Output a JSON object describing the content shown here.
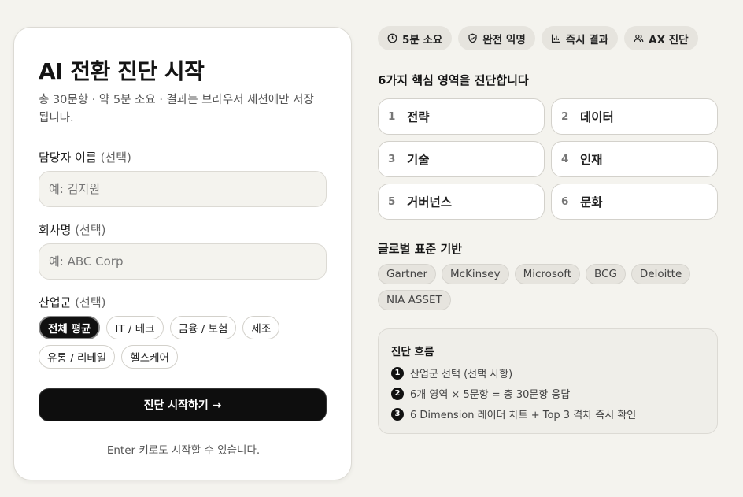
{
  "form": {
    "title": "AI 전환 진단 시작",
    "subtitle": "총 30문항 · 약 5분 소요 · 결과는 브라우저 세션에만 저장됩니다.",
    "name_label": "담당자 이름",
    "name_optional": "(선택)",
    "name_placeholder": "예: 김지원",
    "company_label": "회사명",
    "company_optional": "(선택)",
    "company_placeholder": "예: ABC Corp",
    "industry_label": "산업군",
    "industry_optional": "(선택)",
    "industries": [
      "전체 평균",
      "IT / 테크",
      "금융 / 보험",
      "제조",
      "유통 / 리테일",
      "헬스케어"
    ],
    "selected_industry": "전체 평균",
    "start_button": "진단 시작하기 →",
    "hint": "Enter 키로도 시작할 수 있습니다."
  },
  "pills": [
    {
      "icon": "clock-icon",
      "label": "5분 소요"
    },
    {
      "icon": "shield-check-icon",
      "label": "완전 익명"
    },
    {
      "icon": "bar-chart-icon",
      "label": "즉시 결과"
    },
    {
      "icon": "users-icon",
      "label": "AX 진단"
    }
  ],
  "dimensions": {
    "title": "6가지 핵심 영역을 진단합니다",
    "items": [
      {
        "num": "1",
        "name": "전략"
      },
      {
        "num": "2",
        "name": "데이터"
      },
      {
        "num": "3",
        "name": "기술"
      },
      {
        "num": "4",
        "name": "인재"
      },
      {
        "num": "5",
        "name": "거버넌스"
      },
      {
        "num": "6",
        "name": "문화"
      }
    ]
  },
  "standards": {
    "title": "글로벌 표준 기반",
    "items": [
      "Gartner",
      "McKinsey",
      "Microsoft",
      "BCG",
      "Deloitte",
      "NIA ASSET"
    ]
  },
  "flow": {
    "title": "진단 흐름",
    "steps": [
      {
        "num": "1",
        "text": "산업군 선택 (선택 사항)"
      },
      {
        "num": "2",
        "text": "6개 영역 × 5문항 = 총 30문항 응답"
      },
      {
        "num": "3",
        "text": "6 Dimension 레이더 차트 + Top 3 격차 즉시 확인"
      }
    ]
  },
  "colors": {
    "background": "#f4f3ee",
    "accent": "#111111",
    "card": "#ffffff"
  }
}
